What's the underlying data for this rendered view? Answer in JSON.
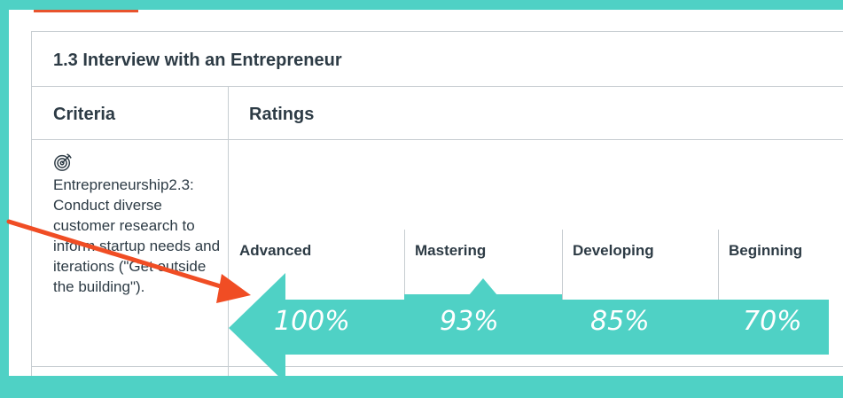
{
  "rubric": {
    "title": "1.3 Interview with an Entrepreneur",
    "criteria_header": "Criteria",
    "ratings_header": "Ratings",
    "criterion": {
      "icon": "target-icon",
      "text": "Entrepreneurship2.3: Conduct diverse customer research to inform startup needs and iterations (\"Get outside the building\")."
    },
    "ratings": [
      {
        "label": "Advanced"
      },
      {
        "label": "Mastering",
        "selected": true
      },
      {
        "label": "Developing"
      },
      {
        "label": "Beginning"
      }
    ]
  },
  "overlay": {
    "percentages": [
      "100%",
      "93%",
      "85%",
      "70%"
    ],
    "arrow_color": "#4fd1c5",
    "pointer_color": "#f04d24"
  },
  "colors": {
    "background": "#4fd1c5",
    "text": "#2d3b45",
    "border": "#c7cdd1",
    "accent": "#e8532d"
  }
}
